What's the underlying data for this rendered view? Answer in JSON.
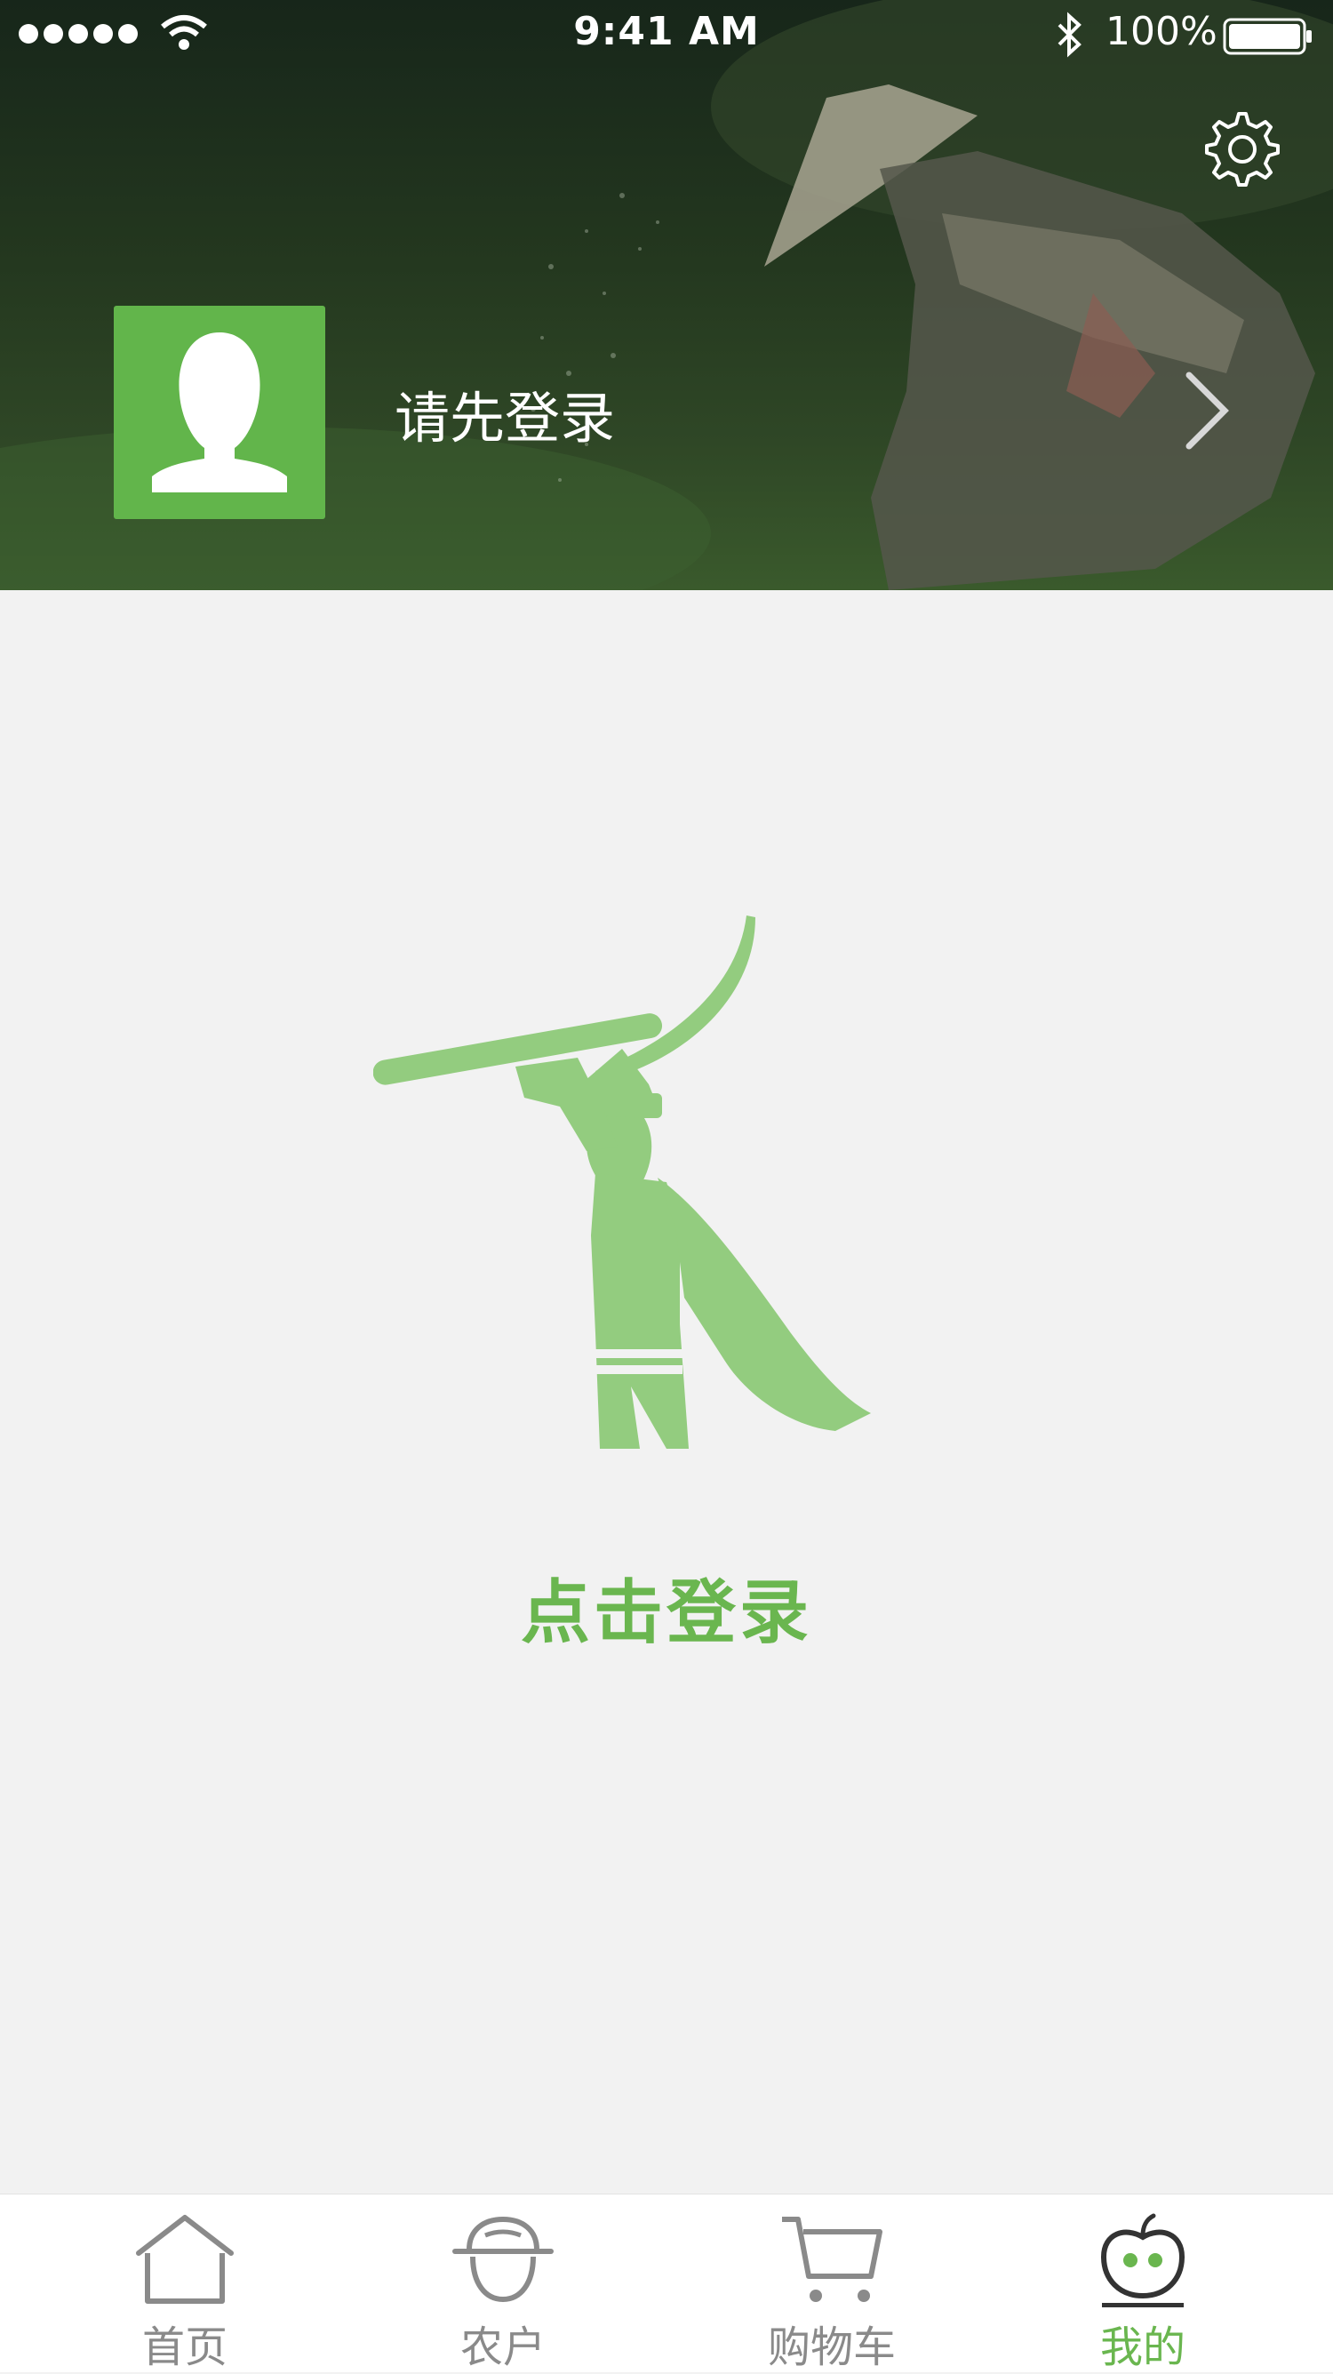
{
  "status_bar": {
    "time": "9:41 AM",
    "battery_percent": "100%"
  },
  "header": {
    "login_prompt": "请先登录"
  },
  "main": {
    "login_button_label": "点击登录"
  },
  "tab_bar": {
    "items": [
      {
        "label": "首页",
        "icon": "home-icon",
        "active": false
      },
      {
        "label": "农户",
        "icon": "farmer-icon",
        "active": false
      },
      {
        "label": "购物车",
        "icon": "cart-icon",
        "active": false
      },
      {
        "label": "我的",
        "icon": "apple-icon",
        "active": true
      }
    ]
  },
  "colors": {
    "accent": "#6ab64f",
    "avatar_bg": "#62b54b",
    "mascot": "#93cc7f",
    "inactive": "#8a8a8a",
    "background": "#f2f2f2"
  }
}
